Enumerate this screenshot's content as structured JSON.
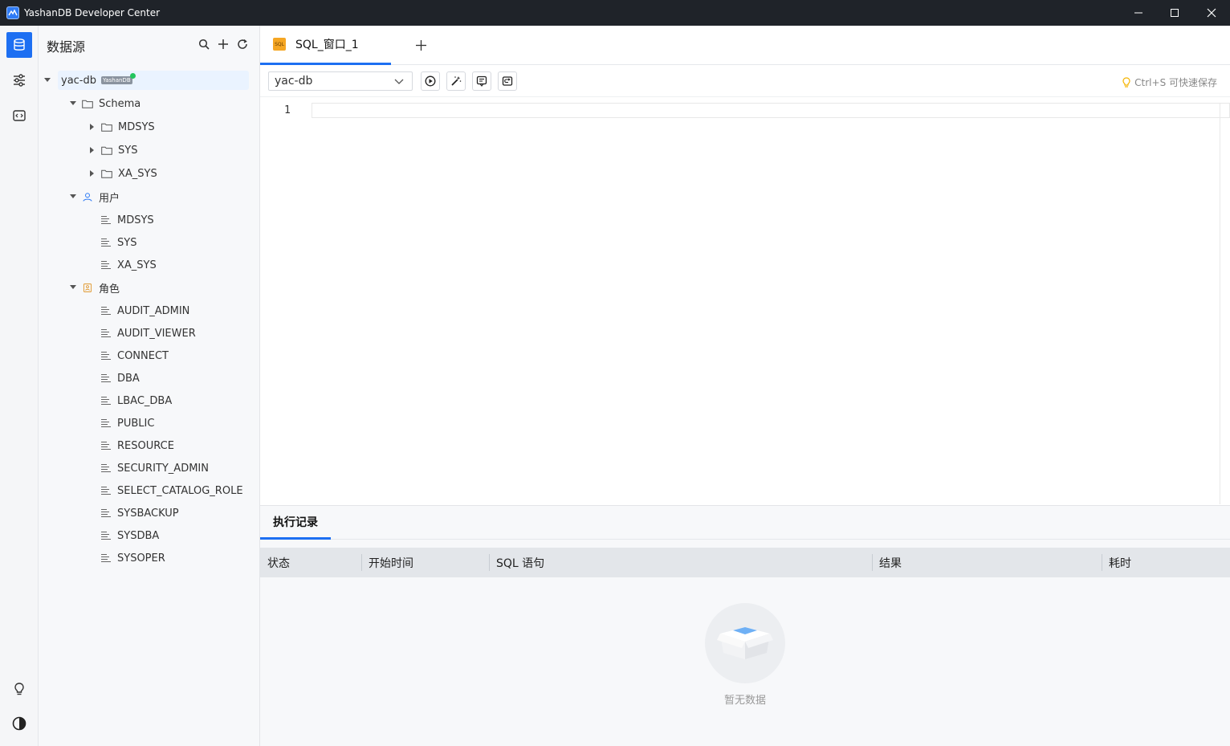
{
  "window": {
    "title": "YashanDB Developer Center"
  },
  "sidebar": {
    "title": "数据源",
    "tree": [
      {
        "label": "yac-db",
        "badge": "YashanDB"
      },
      {
        "label": "Schema"
      },
      {
        "label": "MDSYS"
      },
      {
        "label": "SYS"
      },
      {
        "label": "XA_SYS"
      },
      {
        "label": "用户"
      },
      {
        "label": "MDSYS"
      },
      {
        "label": "SYS"
      },
      {
        "label": "XA_SYS"
      },
      {
        "label": "角色"
      },
      {
        "label": "AUDIT_ADMIN"
      },
      {
        "label": "AUDIT_VIEWER"
      },
      {
        "label": "CONNECT"
      },
      {
        "label": "DBA"
      },
      {
        "label": "LBAC_DBA"
      },
      {
        "label": "PUBLIC"
      },
      {
        "label": "RESOURCE"
      },
      {
        "label": "SECURITY_ADMIN"
      },
      {
        "label": "SELECT_CATALOG_ROLE"
      },
      {
        "label": "SYSBACKUP"
      },
      {
        "label": "SYSDBA"
      },
      {
        "label": "SYSOPER"
      }
    ]
  },
  "editor": {
    "tab_label": "SQL_窗口_1",
    "tab_icon_text": "SQL",
    "datasource": "yac-db",
    "hint": "Ctrl+S 可快速保存",
    "line_number": "1"
  },
  "results": {
    "tab_label": "执行记录",
    "columns": [
      "状态",
      "开始时间",
      "SQL 语句",
      "结果",
      "耗时"
    ],
    "empty_text": "暂无数据"
  },
  "colors": {
    "accent": "#1d6ff2",
    "titlebar": "#1f2329"
  }
}
